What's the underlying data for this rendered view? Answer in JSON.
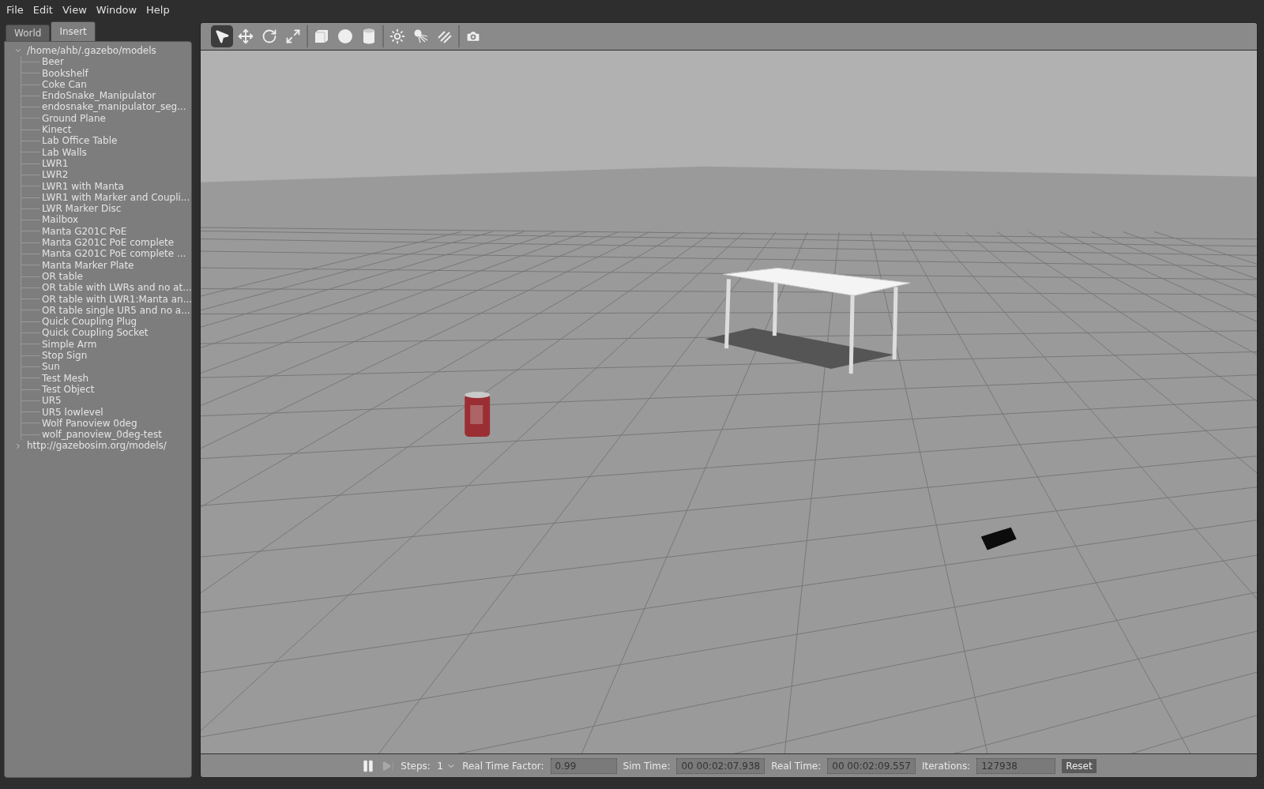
{
  "menu": [
    "File",
    "Edit",
    "View",
    "Window",
    "Help"
  ],
  "tabs": [
    {
      "label": "World",
      "selected": false
    },
    {
      "label": "Insert",
      "selected": true
    }
  ],
  "tree": [
    {
      "label": "/home/ahb/.gazebo/models",
      "expanded": true,
      "children": [
        {
          "label": "Beer"
        },
        {
          "label": "Bookshelf"
        },
        {
          "label": "Coke Can"
        },
        {
          "label": "EndoSnake_Manipulator"
        },
        {
          "label": "endosnake_manipulator_seg..."
        },
        {
          "label": "Ground Plane"
        },
        {
          "label": "Kinect"
        },
        {
          "label": "Lab Office Table"
        },
        {
          "label": "Lab Walls"
        },
        {
          "label": "LWR1"
        },
        {
          "label": "LWR2"
        },
        {
          "label": "LWR1 with Manta"
        },
        {
          "label": "LWR1 with Marker and Coupli..."
        },
        {
          "label": "LWR Marker Disc"
        },
        {
          "label": "Mailbox"
        },
        {
          "label": "Manta G201C PoE"
        },
        {
          "label": "Manta G201C PoE complete"
        },
        {
          "label": "Manta G201C PoE complete ..."
        },
        {
          "label": "Manta Marker Plate"
        },
        {
          "label": "OR table"
        },
        {
          "label": "OR table with LWRs and no at..."
        },
        {
          "label": "OR table with LWR1:Manta an..."
        },
        {
          "label": "OR table single UR5 and no a..."
        },
        {
          "label": "Quick Coupling Plug"
        },
        {
          "label": "Quick Coupling Socket"
        },
        {
          "label": "Simple Arm"
        },
        {
          "label": "Stop Sign"
        },
        {
          "label": "Sun"
        },
        {
          "label": "Test Mesh"
        },
        {
          "label": "Test Object"
        },
        {
          "label": "UR5"
        },
        {
          "label": "UR5 lowlevel"
        },
        {
          "label": "Wolf Panoview 0deg"
        },
        {
          "label": "wolf_panoview_0deg-test"
        }
      ]
    },
    {
      "label": "http://gazebosim.org/models/",
      "expanded": false
    }
  ],
  "toolbar": [
    [
      {
        "kind": "select",
        "selected": true
      },
      {
        "kind": "translate",
        "selected": false
      },
      {
        "kind": "rotate",
        "selected": false
      },
      {
        "kind": "scale",
        "selected": false
      }
    ],
    [
      {
        "kind": "box",
        "selected": false
      },
      {
        "kind": "sphere",
        "selected": false
      },
      {
        "kind": "cylinder",
        "selected": false
      }
    ],
    [
      {
        "kind": "point-light",
        "selected": false
      },
      {
        "kind": "spot-light",
        "selected": false
      },
      {
        "kind": "directional-light",
        "selected": false
      }
    ],
    [
      {
        "kind": "screenshot",
        "selected": false
      }
    ]
  ],
  "status_bar": {
    "steps_label": "Steps:",
    "steps": "1",
    "fields": [
      {
        "label": "Real Time Factor:",
        "value": "0.99"
      },
      {
        "label": "Sim Time:",
        "value": "00 00:02:07.938"
      },
      {
        "label": "Real Time:",
        "value": "00 00:02:09.557"
      },
      {
        "label": "Iterations:",
        "value": "127938"
      }
    ],
    "reset": "Reset"
  }
}
